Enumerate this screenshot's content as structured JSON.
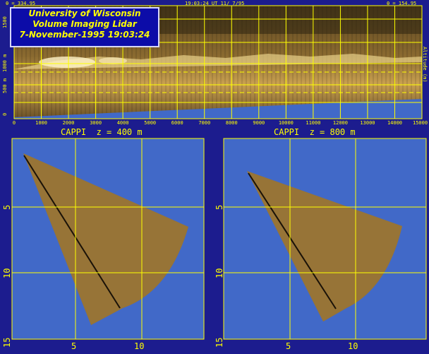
{
  "header": {
    "left_angle": "θ = 334.95",
    "timestamp": "19:03:24 UT 11/ 7/95",
    "right_angle": "θ = 154.95"
  },
  "title": {
    "line1": "University of Wisconsin",
    "line2": "Volume Imaging Lidar",
    "line3": "7-November-1995 19:03:24"
  },
  "rhi": {
    "y_tick_labels": [
      "1500",
      "1000 m",
      "500 m",
      "0"
    ],
    "y_tick_values": [
      1500,
      1000,
      500,
      0
    ],
    "x_tick_labels": [
      "0",
      "1000",
      "2000",
      "3000",
      "4000",
      "5000",
      "6000",
      "7000",
      "8000",
      "9000",
      "10000",
      "11000",
      "12000",
      "13000",
      "14000",
      "15000"
    ],
    "right_axis_label": "Altitude (m)",
    "dashed_levels": [
      800,
      400
    ]
  },
  "cappi_left": {
    "title": "CAPPI  z = 400 m",
    "y_tick_labels": [
      "5",
      "10",
      "15"
    ],
    "x_tick_labels": [
      "5",
      "10"
    ]
  },
  "cappi_right": {
    "title": "CAPPI  z = 800 m",
    "y_tick_labels": [
      "5",
      "10",
      "15"
    ],
    "x_tick_labels": [
      "5",
      "10"
    ]
  },
  "colors": {
    "frame": "#1c1c8e",
    "sky": "#4169c8",
    "grid": "#ffff00",
    "aerosol": "#8a6a34"
  }
}
